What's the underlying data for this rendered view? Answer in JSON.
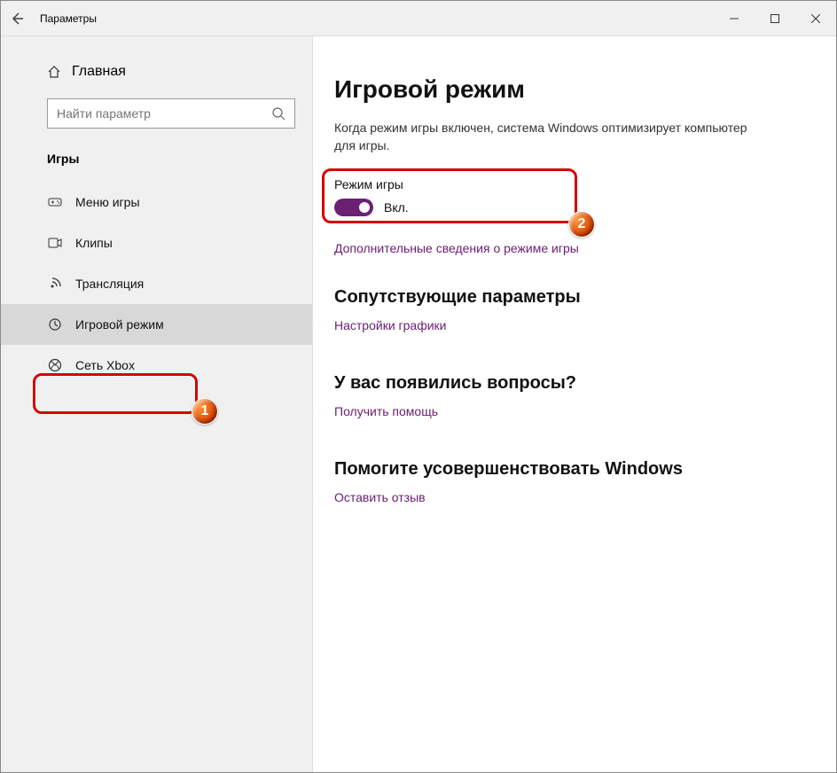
{
  "window": {
    "title": "Параметры"
  },
  "sidebar": {
    "home_label": "Главная",
    "search_placeholder": "Найти параметр",
    "category": "Игры",
    "items": [
      {
        "label": "Меню игры"
      },
      {
        "label": "Клипы"
      },
      {
        "label": "Трансляция"
      },
      {
        "label": "Игровой режим"
      },
      {
        "label": "Сеть Xbox"
      }
    ]
  },
  "main": {
    "title": "Игровой режим",
    "description": "Когда режим игры включен, система Windows оптимизирует компьютер для игры.",
    "toggle_label": "Режим игры",
    "toggle_state": "Вкл.",
    "more_info_link": "Дополнительные сведения о режиме игры",
    "related_heading": "Сопутствующие параметры",
    "graphics_link": "Настройки графики",
    "help_heading": "У вас появились вопросы?",
    "help_link": "Получить помощь",
    "feedback_heading": "Помогите усовершенствовать Windows",
    "feedback_link": "Оставить отзыв"
  },
  "annotations": {
    "badge1": "1",
    "badge2": "2"
  }
}
